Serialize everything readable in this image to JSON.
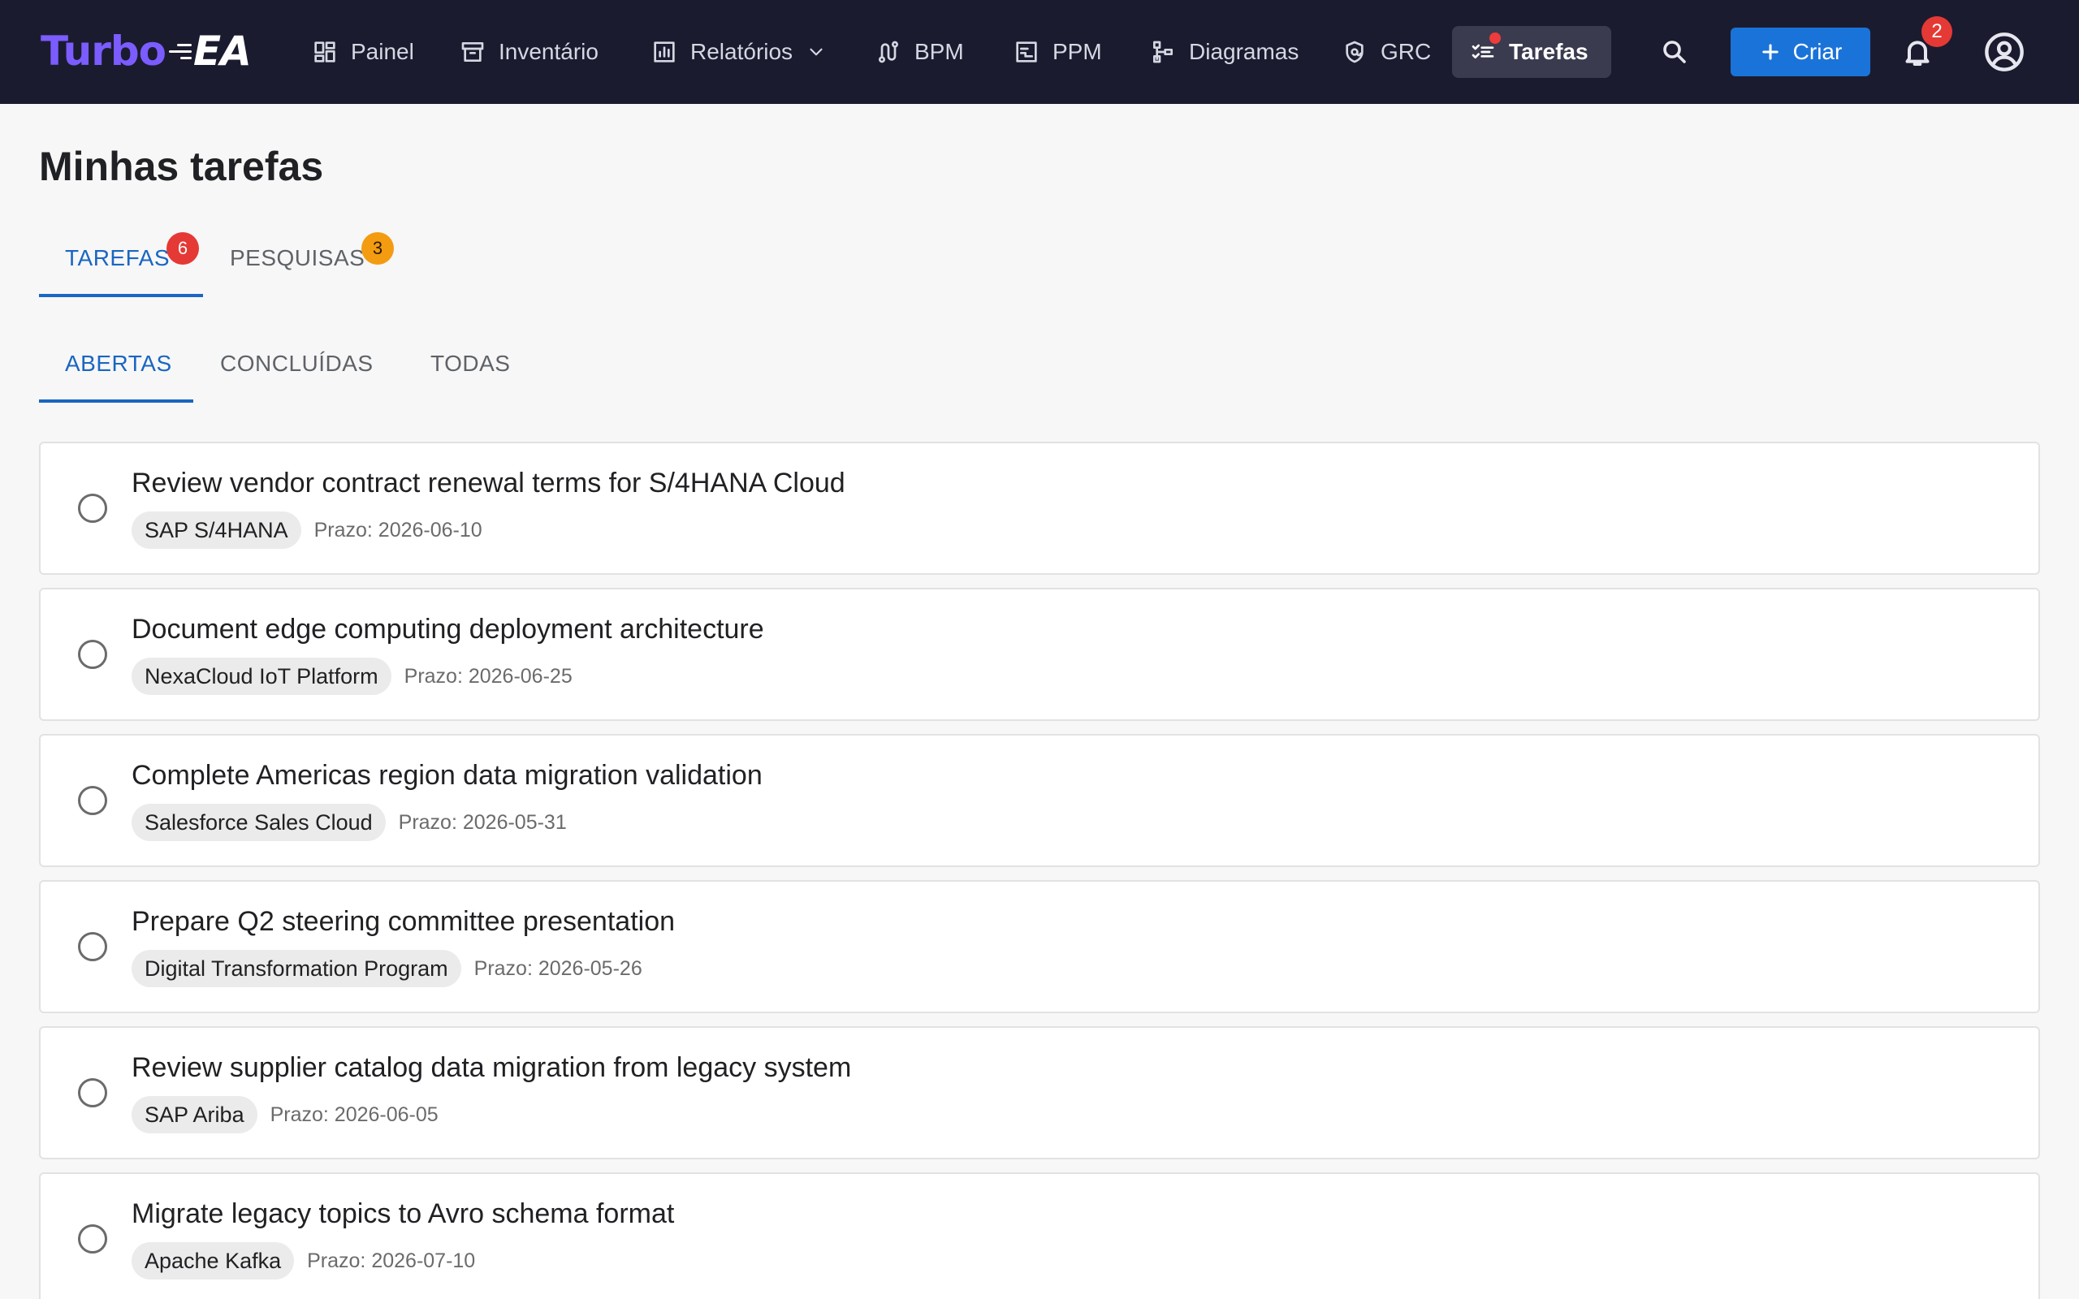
{
  "brand": {
    "part1": "Turbo",
    "part2": "EA"
  },
  "nav": [
    {
      "label": "Painel",
      "icon": "dashboard-icon"
    },
    {
      "label": "Inventário",
      "icon": "archive-icon"
    },
    {
      "label": "Relatórios",
      "icon": "report-chart-icon"
    },
    {
      "label": "BPM",
      "icon": "process-route-icon"
    },
    {
      "label": "PPM",
      "icon": "project-board-icon"
    },
    {
      "label": "Diagramas",
      "icon": "diagram-tree-icon"
    },
    {
      "label": "GRC",
      "icon": "shield-icon"
    },
    {
      "label": "Tarefas",
      "icon": "checklist-icon"
    }
  ],
  "header": {
    "create_label": "Criar",
    "notifications_count": "2"
  },
  "page": {
    "title": "Minhas tarefas"
  },
  "main_tabs": [
    {
      "label": "Tarefas",
      "count": "6",
      "color": "#e53935"
    },
    {
      "label": "Pesquisas",
      "count": "3",
      "color": "#f39c12"
    }
  ],
  "sub_tabs": [
    {
      "label": "Abertas"
    },
    {
      "label": "Concluídas"
    },
    {
      "label": "Todas"
    }
  ],
  "tasks": [
    {
      "title": "Review vendor contract renewal terms for S/4HANA Cloud",
      "tag": "SAP S/4HANA",
      "due": "Prazo: 2026-06-10"
    },
    {
      "title": "Document edge computing deployment architecture",
      "tag": "NexaCloud IoT Platform",
      "due": "Prazo: 2026-06-25"
    },
    {
      "title": "Complete Americas region data migration validation",
      "tag": "Salesforce Sales Cloud",
      "due": "Prazo: 2026-05-31"
    },
    {
      "title": "Prepare Q2 steering committee presentation",
      "tag": "Digital Transformation Program",
      "due": "Prazo: 2026-05-26"
    },
    {
      "title": "Review supplier catalog data migration from legacy system",
      "tag": "SAP Ariba",
      "due": "Prazo: 2026-06-05"
    },
    {
      "title": "Migrate legacy topics to Avro schema format",
      "tag": "Apache Kafka",
      "due": "Prazo: 2026-07-10"
    }
  ]
}
